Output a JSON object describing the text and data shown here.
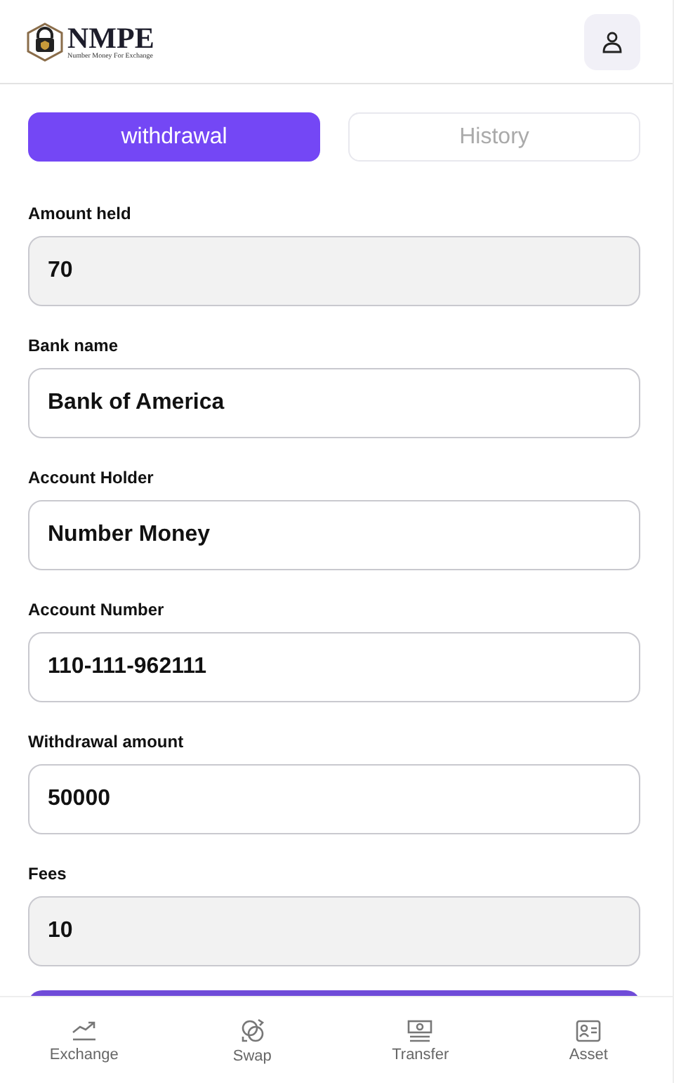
{
  "header": {
    "logo_title": "NMPE",
    "logo_subtitle": "Number Money For Exchange"
  },
  "tabs": [
    {
      "label": "withdrawal",
      "selected": true
    },
    {
      "label": "History",
      "selected": false
    }
  ],
  "fields": [
    {
      "label": "Amount held",
      "value": "70",
      "readonly": true
    },
    {
      "label": "Bank name",
      "value": "Bank of America",
      "readonly": false
    },
    {
      "label": "Account Holder",
      "value": "Number Money",
      "readonly": false
    },
    {
      "label": "Account Number",
      "value": "110-111-962111",
      "readonly": false
    },
    {
      "label": "Withdrawal amount",
      "value": "50000",
      "readonly": false
    },
    {
      "label": "Fees",
      "value": "10",
      "readonly": true
    }
  ],
  "nav": [
    {
      "label": "Exchange",
      "kind": "exchange"
    },
    {
      "label": "Swap",
      "kind": "swap"
    },
    {
      "label": "Transfer",
      "kind": "transfer"
    },
    {
      "label": "Asset",
      "kind": "asset"
    }
  ]
}
